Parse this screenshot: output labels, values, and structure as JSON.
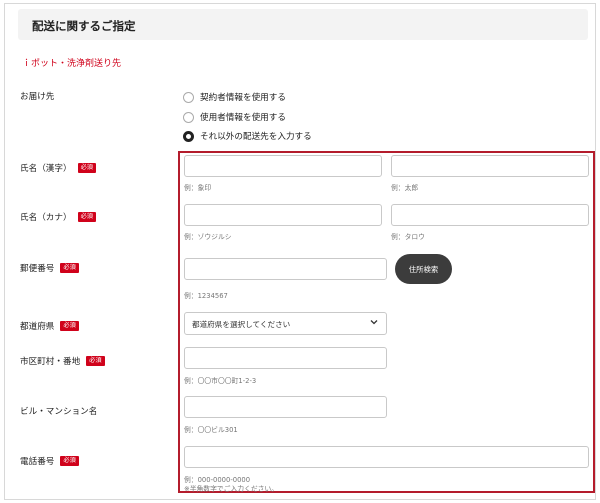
{
  "header": {
    "title": "配送に関するご指定"
  },
  "notice": "ｉポット・洗浄剤送り先",
  "delivery": {
    "label": "お届け先",
    "options": [
      {
        "label": "契約者情報を使用する",
        "checked": false
      },
      {
        "label": "使用者情報を使用する",
        "checked": false
      },
      {
        "label": "それ以外の配送先を入力する",
        "checked": true
      }
    ]
  },
  "required_badge": "必須",
  "fields": {
    "name_kanji": {
      "label": "氏名（漢字）",
      "hint_last": "例：象印",
      "hint_first": "例：太郎"
    },
    "name_kana": {
      "label": "氏名（カナ）",
      "hint_last": "例：ゾウジルシ",
      "hint_first": "例：タロウ"
    },
    "postal": {
      "label": "郵便番号",
      "hint": "例：1234567",
      "search_button": "住所検索"
    },
    "prefecture": {
      "label": "都道府県",
      "selected": "都道府県を選択してください"
    },
    "address": {
      "label": "市区町村・番地",
      "hint": "例：〇〇市〇〇町1-2-3"
    },
    "building": {
      "label": "ビル・マンション名",
      "hint": "例：〇〇ビル301"
    },
    "phone": {
      "label": "電話番号",
      "hint": "例：000-0000-0000",
      "note": "※半角数字でご入力ください。"
    }
  },
  "colors": {
    "required_bg": "#d0021b",
    "highlight_border": "#b41c2c",
    "button_bg": "#3c3c3c"
  },
  "icons": {
    "select_arrow": "chevron-down-icon"
  }
}
